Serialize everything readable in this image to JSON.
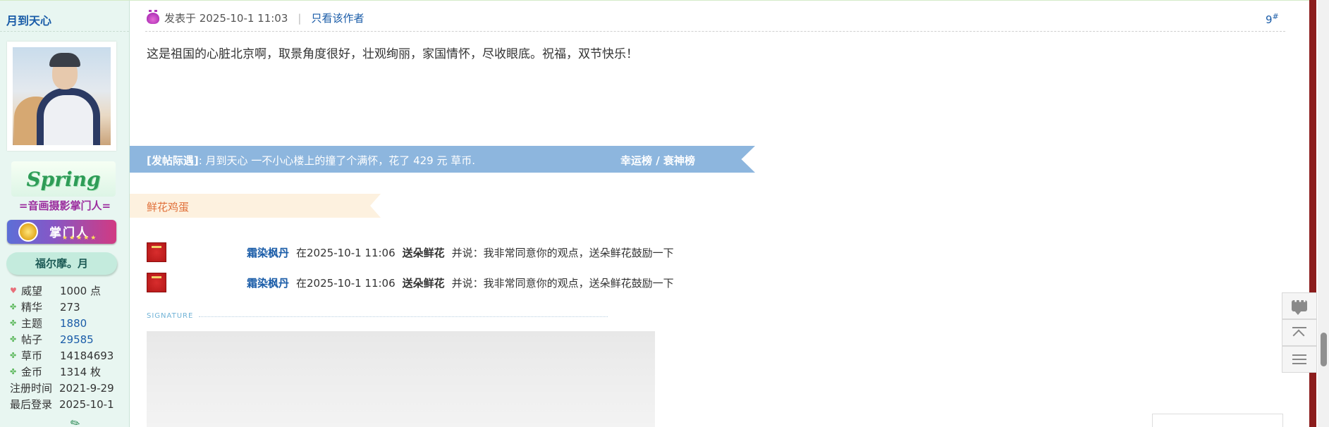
{
  "author": {
    "name": "月到天心",
    "group_title": "=音画摄影掌门人=",
    "medal_text": "Spring",
    "rank_badge": "掌门人",
    "nickname": "福尔摩。月",
    "stats": [
      {
        "label": "威望",
        "value": "1000 点",
        "icon": "heart-icon",
        "link": false
      },
      {
        "label": "精华",
        "value": "273",
        "icon": "clover-icon",
        "link": false
      },
      {
        "label": "主题",
        "value": "1880",
        "icon": "clover-icon",
        "link": true
      },
      {
        "label": "帖子",
        "value": "29585",
        "icon": "clover-icon",
        "link": true
      },
      {
        "label": "草币",
        "value": "14184693",
        "icon": "clover-icon",
        "link": false
      },
      {
        "label": "金币",
        "value": "1314 枚",
        "icon": "clover-icon",
        "link": false
      },
      {
        "label": "注册时间",
        "value": "2021-9-29",
        "icon": "",
        "link": false
      },
      {
        "label": "最后登录",
        "value": "2025-10-1",
        "icon": "",
        "link": false
      }
    ]
  },
  "post": {
    "posted_at": "发表于 2025-10-1 11:03",
    "only_author": "只看该作者",
    "floor": "9",
    "floor_mark": "#",
    "body": "这是祖国的心脏北京啊，取景角度很好，壮观绚丽，家国情怀，尽收眼底。祝福，双节快乐！"
  },
  "reward": {
    "tag": "[发帖际遇]",
    "text": ": 月到天心 一不小心楼上的撞了个满怀，花了 429 元 草币.",
    "link": "幸运榜 / 衰神榜"
  },
  "flowers": {
    "title": "鲜花鸡蛋",
    "entries": [
      {
        "user": "霜染枫丹",
        "when": "在2025-10-1 11:06",
        "action": "送朵鲜花",
        "message": "并说：我非常同意你的观点，送朵鲜花鼓励一下"
      },
      {
        "user": "霜染枫丹",
        "when": "在2025-10-1 11:06",
        "action": "送朵鲜花",
        "message": "并说：我非常同意你的观点，送朵鲜花鼓励一下"
      }
    ]
  },
  "signature": {
    "label": "SIGNATURE"
  },
  "tools": [
    {
      "name": "comment-icon"
    },
    {
      "name": "back-to-top-icon"
    },
    {
      "name": "list-icon"
    }
  ],
  "colors": {
    "sidebar_bg": "#e8f6f1",
    "link_blue": "#1a5ca8",
    "reward_banner": "#8db6de",
    "flower_banner": "#fdf1df",
    "flower_text": "#e0703a",
    "group_title": "#9b2d9e"
  }
}
